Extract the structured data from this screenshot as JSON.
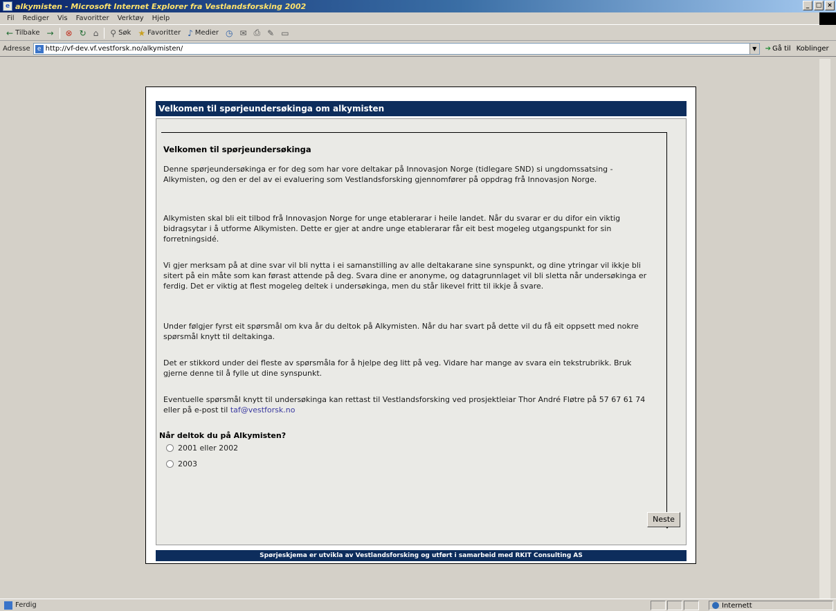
{
  "window": {
    "title": "alkymisten - Microsoft Internet Explorer fra Vestlandsforsking 2002",
    "controls": [
      "_",
      "□",
      "×"
    ]
  },
  "menu": [
    "Fil",
    "Rediger",
    "Vis",
    "Favoritter",
    "Verktøy",
    "Hjelp"
  ],
  "toolbar": {
    "back": "Tilbake",
    "back_arrow": "←",
    "forward_arrow": "→",
    "search": "Søk",
    "favorites": "Favoritter",
    "media": "Medier"
  },
  "address": {
    "label": "Adresse",
    "url": "http://vf-dev.vf.vestforsk.no/alkymisten/",
    "go": "Gå til",
    "links": "Koblinger"
  },
  "page": {
    "header": "Velkomen til spørjeundersøkinga om alkymisten",
    "heading": "Velkomen til spørjeundersøkinga",
    "p1": "Denne spørjeundersøkinga er for deg som har vore deltakar på Innovasjon Norge (tidlegare SND) si ungdomssatsing - Alkymisten, og den er del av ei evaluering som Vestlandsforsking gjennomfører på oppdrag frå Innovasjon Norge.",
    "p2": "Alkymisten skal bli eit tilbod frå Innovasjon Norge for unge etablerarar i heile landet. Når du svarar er du difor ein viktig bidragsytar i å utforme Alkymisten. Dette er gjer at andre unge etablerarar får eit best mogeleg utgangspunkt for sin forretningsidé.",
    "p3": "Vi gjer merksam på at dine svar vil bli nytta i ei samanstilling av alle deltakarane sine synspunkt, og dine ytringar vil ikkje bli sitert på ein måte som kan førast attende på deg. Svara dine er anonyme, og datagrunnlaget vil bli sletta når undersøkinga er ferdig. Det er viktig at flest mogeleg deltek i undersøkinga, men du står likevel fritt til ikkje å svare.",
    "p4": "Under følgjer fyrst eit spørsmål om kva år du deltok på Alkymisten. Når du har svart på dette vil du få eit oppsett med nokre spørsmål knytt til deltakinga.",
    "p5": "Det er stikkord under dei fleste av spørsmåla for å hjelpe deg litt på veg. Vidare har mange av svara ein tekstrubrikk. Bruk gjerne denne til å fylle ut dine synspunkt.",
    "p6_text": "Eventuelle spørsmål knytt til undersøkinga kan rettast til Vestlandsforsking ved prosjektleiar Thor André Fløtre på 57 67 61 74 eller på e-post til ",
    "p6_email": "taf@vestforsk.no",
    "question": "Når deltok du på Alkymisten?",
    "option1": "2001 eller 2002",
    "option2": "2003",
    "next": "Neste",
    "footer": "Spørjeskjema er utvikla av Vestlandsforsking og utført i samarbeid med RKIT Consulting AS"
  },
  "status": {
    "left": "Ferdig",
    "zone": "Internett"
  }
}
